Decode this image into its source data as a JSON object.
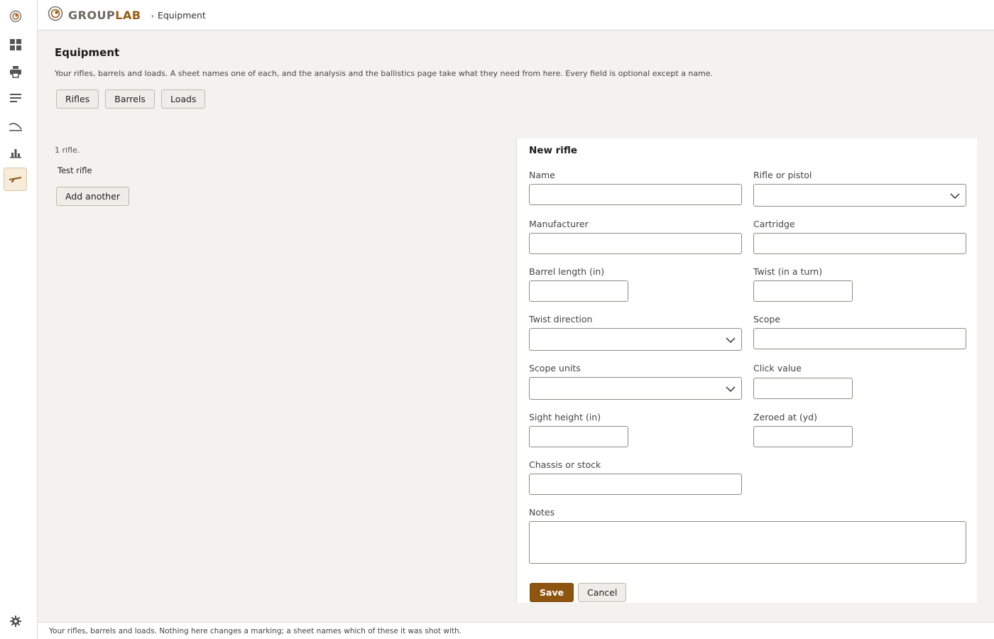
{
  "app": {
    "brand_part1": "GROUP",
    "brand_part2": "LAB",
    "breadcrumb_sep": "›",
    "breadcrumb_current": "Equipment",
    "accent_color": "#8e5510"
  },
  "rail": {
    "items": [
      {
        "name": "target-icon",
        "active": false
      },
      {
        "name": "dashboard-icon",
        "active": false
      },
      {
        "name": "printer-icon",
        "active": false
      },
      {
        "name": "list-icon",
        "active": false
      },
      {
        "name": "trajectory-icon",
        "active": false
      },
      {
        "name": "bar-chart-icon",
        "active": false
      },
      {
        "name": "rifle-icon",
        "active": true
      }
    ],
    "settings_icon": "gear-icon"
  },
  "page": {
    "title": "Equipment",
    "description": "Your rifles, barrels and loads. A sheet names one of each, and the analysis and the ballistics page take what they need from here. Every field is optional except a name.",
    "tabs": [
      "Rifles",
      "Barrels",
      "Loads"
    ]
  },
  "list": {
    "count": "1 rifle.",
    "items": [
      "Test rifle"
    ],
    "add_label": "Add another"
  },
  "form": {
    "title": "New rifle",
    "name_label": "Name",
    "type_label": "Rifle or pistol",
    "manufacturer_label": "Manufacturer",
    "cartridge_label": "Cartridge",
    "barrel_length_label": "Barrel length (in)",
    "twist_label": "Twist (in a turn)",
    "twist_direction_label": "Twist direction",
    "scope_label": "Scope",
    "scope_units_label": "Scope units",
    "click_value_label": "Click value",
    "sight_height_label": "Sight height (in)",
    "zeroed_label": "Zeroed at (yd)",
    "chassis_label": "Chassis or stock",
    "notes_label": "Notes",
    "save_label": "Save",
    "cancel_label": "Cancel",
    "values": {
      "name": "",
      "type": "",
      "manufacturer": "",
      "cartridge": "",
      "barrel_length": "",
      "twist": "",
      "twist_direction": "",
      "scope": "",
      "scope_units": "",
      "click_value": "",
      "sight_height": "",
      "zeroed": "",
      "chassis": "",
      "notes": ""
    }
  },
  "footer": {
    "text": "Your rifles, barrels and loads. Nothing here changes a marking; a sheet names which of these it was shot with."
  }
}
